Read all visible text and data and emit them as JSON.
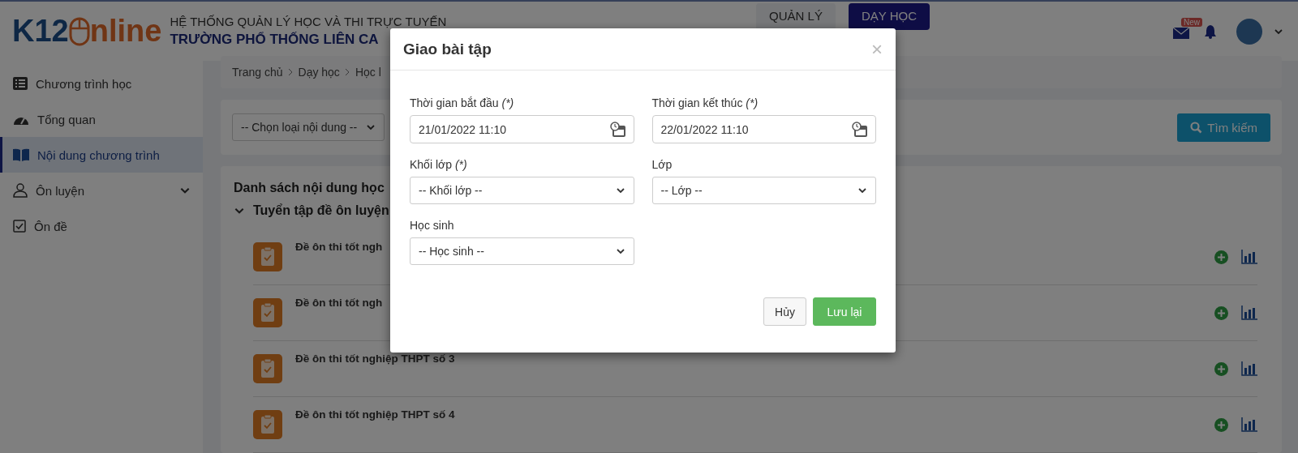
{
  "header": {
    "logo": {
      "left": "K12",
      "right": "nline"
    },
    "system_title": "HỆ THỐNG QUẢN LÝ HỌC VÀ THI TRỰC TUYẾN",
    "school_name": "TRƯỜNG PHỔ THỐNG LIÊN CA",
    "nav": [
      {
        "label": "QUẢN LÝ",
        "selected": false
      },
      {
        "label": "DẠY HỌC",
        "selected": true
      }
    ],
    "mail_badge": "New"
  },
  "sidebar": {
    "items": [
      {
        "label": "Chương trình học",
        "selected": false,
        "expandable": false
      },
      {
        "label": "Tổng quan",
        "selected": false,
        "expandable": false
      },
      {
        "label": "Nội dung chương trình",
        "selected": true,
        "expandable": false
      },
      {
        "label": "Ôn luyện",
        "selected": false,
        "expandable": true
      },
      {
        "label": "Ôn đề",
        "selected": false,
        "expandable": false
      }
    ]
  },
  "breadcrumb": [
    "Trang chủ",
    "Dạy học",
    "Học l"
  ],
  "filter": {
    "type_select": "-- Chọn loại nội dung --",
    "search_button": "Tìm kiếm"
  },
  "content": {
    "title": "Danh sách nội dung học",
    "group": "Tuyển tập đề ôn luyện",
    "rows": [
      {
        "title": "Đề ôn thi tốt ngh"
      },
      {
        "title": "Đề ôn thi tốt ngh"
      },
      {
        "title": "Đề ôn thi tốt nghiệp THPT số 3"
      },
      {
        "title": "Đề ôn thi tốt nghiệp THPT số 4"
      }
    ]
  },
  "modal": {
    "title": "Giao bài tập",
    "close": "×",
    "fields": [
      {
        "kind": "date",
        "label": "Thời gian bắt đầu",
        "required_mark": "(*)",
        "value": "21/01/2022 11:10"
      },
      {
        "kind": "date",
        "label": "Thời gian kết thúc",
        "required_mark": "(*)",
        "value": "22/01/2022 11:10"
      },
      {
        "kind": "select",
        "label": "Khối lớp",
        "required_mark": "(*)",
        "value": "-- Khối lớp --"
      },
      {
        "kind": "select",
        "label": "Lớp",
        "value": "-- Lớp --"
      },
      {
        "kind": "select",
        "label": "Học sinh",
        "value": "-- Học sinh --"
      }
    ],
    "buttons": [
      {
        "label": "Hủy",
        "kind": "default"
      },
      {
        "label": "Lưu lại",
        "kind": "primary"
      }
    ]
  }
}
